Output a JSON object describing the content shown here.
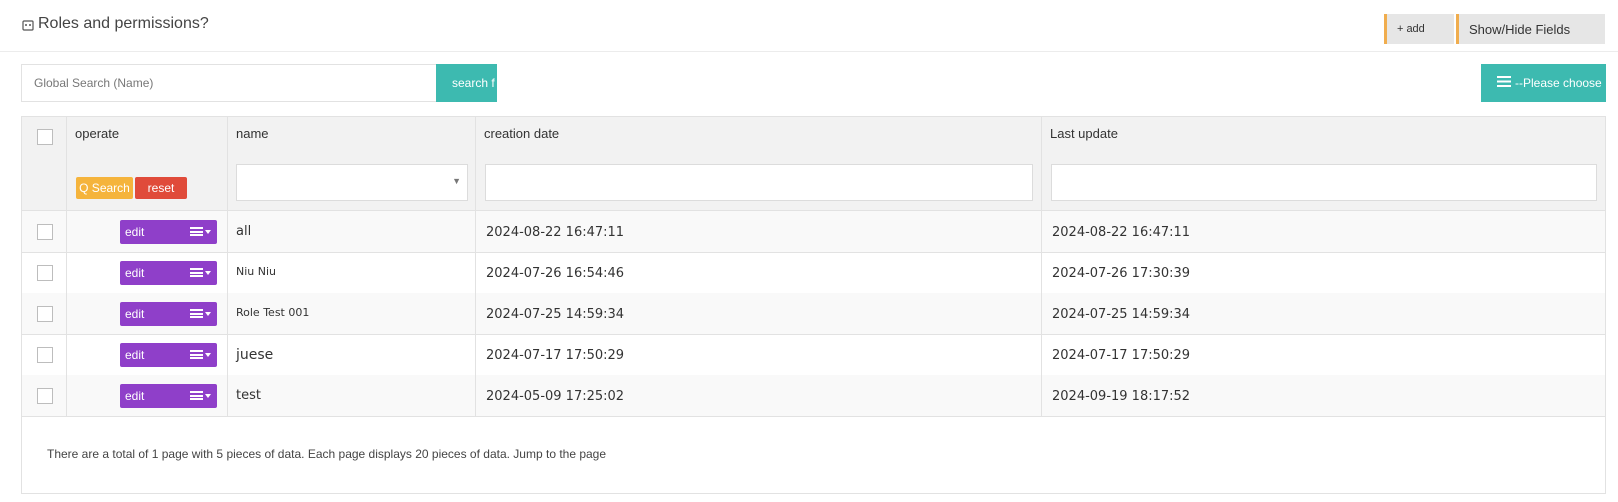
{
  "header": {
    "title": "Roles and permissions?",
    "add_label": "add",
    "fields_label": "Show/Hide Fields",
    "accent": "#f0ad4e"
  },
  "search": {
    "placeholder": "Global Search (Name)",
    "button_label": "search f",
    "choose_label": "--Please choose",
    "accent": "#3dbab0"
  },
  "table": {
    "columns": [
      "operate",
      "name",
      "creation date",
      "Last update"
    ],
    "qsearch_label": "Q Search",
    "reset_label": "reset",
    "edit_label": "edit",
    "rows": [
      {
        "name": "all",
        "created": "2024-08-22 16:47:11",
        "updated": "2024-08-22 16:47:11"
      },
      {
        "name": "Niu Niu",
        "created": "2024-07-26 16:54:46",
        "updated": "2024-07-26 17:30:39"
      },
      {
        "name": "Role Test 001",
        "created": "2024-07-25 14:59:34",
        "updated": "2024-07-25 14:59:34"
      },
      {
        "name": "juese",
        "created": "2024-07-17 17:50:29",
        "updated": "2024-07-17 17:50:29"
      },
      {
        "name": "test",
        "created": "2024-05-09 17:25:02",
        "updated": "2024-09-19 18:17:52"
      }
    ],
    "colors": {
      "edit": "#8f3fc9",
      "qsearch": "#f5b43c",
      "reset": "#e04b3a"
    }
  },
  "pagination": {
    "text": "There are a total of 1 page with 5 pieces of data. Each page displays 20 pieces of data. Jump to the page"
  }
}
